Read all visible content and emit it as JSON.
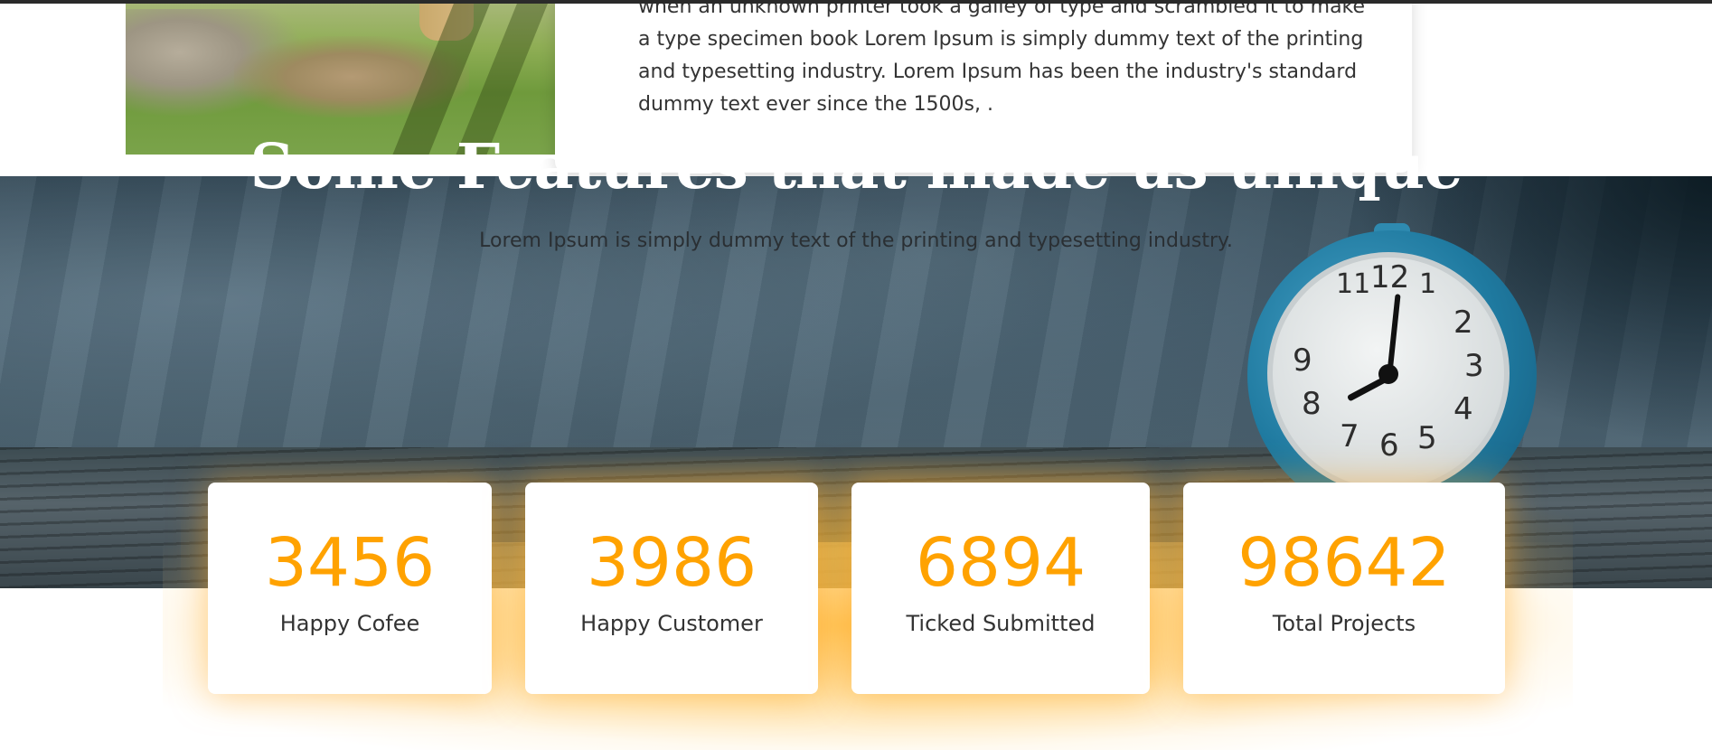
{
  "about": {
    "paragraph": "when an unknown printer took a galley of type and scrambled it to make a type specimen book Lorem Ipsum is simply dummy text of the printing and typesetting industry. Lorem Ipsum has been the industry's standard dummy text ever since the 1500s, ."
  },
  "features": {
    "title": "Some Features that made us unique",
    "subtitle": "Lorem Ipsum is simply dummy text of the printing and typesetting industry.",
    "stats": [
      {
        "value": "3456",
        "label": "Happy Cofee"
      },
      {
        "value": "3986",
        "label": "Happy Customer"
      },
      {
        "value": "6894",
        "label": "Ticked Submitted"
      },
      {
        "value": "98642",
        "label": "Total Projects"
      }
    ]
  },
  "colors": {
    "accent": "#ffa200",
    "hero_bg": "#3e5666",
    "text": "#333333"
  }
}
